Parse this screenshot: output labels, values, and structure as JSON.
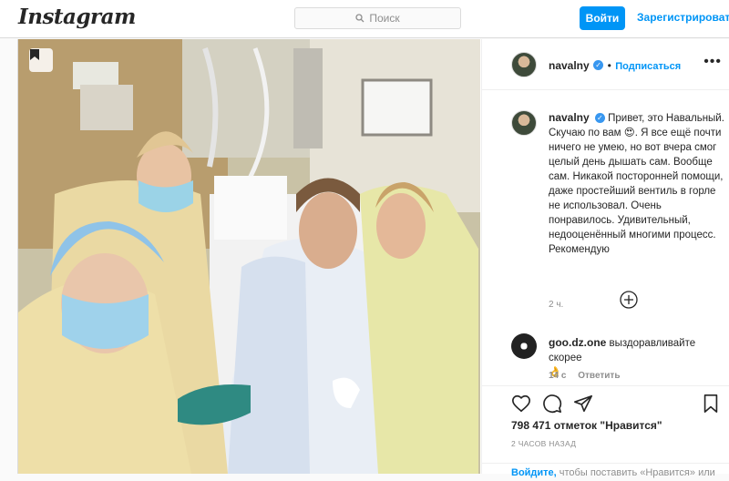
{
  "header": {
    "logo": "Instagram",
    "search_placeholder": "Поиск",
    "login_label": "Войти",
    "signup_label": "Зарегистрироваться"
  },
  "post": {
    "author": "navalny",
    "follow_label": "Подписаться",
    "separator": "•",
    "caption": "Привет, это Навальный. Скучаю по вам 😍. Я все ещё почти ничего не умею, но вот вчера смог целый день дышать сам. Вообще сам. Никакой посторонней помощи, даже простейший вентиль в горле не использовал. Очень понравилось. Удивительный, недооценённый многими процесс. Рекомендую",
    "caption_time": "2 ч.",
    "likes_text": "798 471 отметок \"Нравится\"",
    "posted_ago": "2 ЧАСОВ НАЗАД",
    "login_link": "Войдите,",
    "login_rest": " чтобы поставить «Нравится» или"
  },
  "comments": [
    {
      "user": "goo.dz.one",
      "text": "выздоравливайте скорее",
      "emoji": "👌",
      "time": "14 с",
      "reply_label": "Ответить"
    }
  ],
  "icons": {
    "search": "search-icon",
    "bookmark_chip": "bookmark-icon",
    "verified": "verified-badge-icon",
    "more": "more-options-icon",
    "load_more": "plus-circle-icon",
    "like": "heart-icon",
    "comment": "comment-icon",
    "share": "share-icon",
    "save": "bookmark-icon"
  },
  "colors": {
    "accent": "#0095f6",
    "verified": "#3897f0",
    "muted": "#8e8e8e",
    "border": "#dbdbdb"
  }
}
